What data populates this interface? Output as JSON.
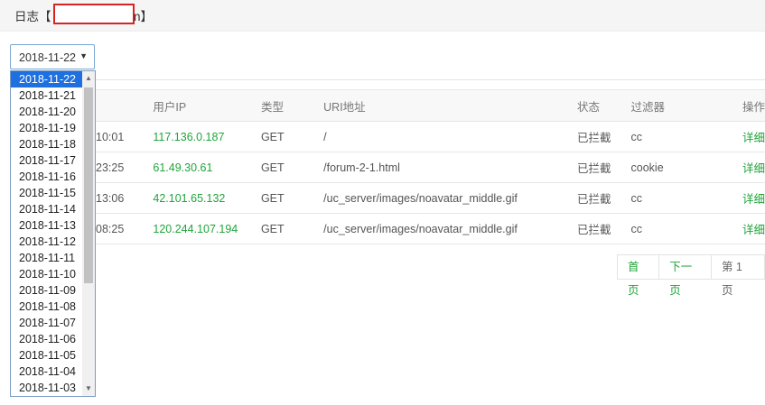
{
  "header": {
    "title_prefix": "日志【",
    "title_visible_tail": "n】"
  },
  "date_select": {
    "value": "2018-11-22"
  },
  "date_options": [
    "2018-11-22",
    "2018-11-21",
    "2018-11-20",
    "2018-11-19",
    "2018-11-18",
    "2018-11-17",
    "2018-11-16",
    "2018-11-15",
    "2018-11-14",
    "2018-11-13",
    "2018-11-12",
    "2018-11-11",
    "2018-11-10",
    "2018-11-09",
    "2018-11-08",
    "2018-11-07",
    "2018-11-06",
    "2018-11-05",
    "2018-11-04",
    "2018-11-03"
  ],
  "table": {
    "headers": {
      "ip": "用户IP",
      "type": "类型",
      "uri": "URI地址",
      "status": "状态",
      "filter": "过滤器",
      "op": "操作"
    },
    "rows": [
      {
        "time": "10:01",
        "ip": "117.136.0.187",
        "type": "GET",
        "uri": "/",
        "status": "已拦截",
        "filter": "cc",
        "op": "详细"
      },
      {
        "time": "23:25",
        "ip": "61.49.30.61",
        "type": "GET",
        "uri": "/forum-2-1.html",
        "status": "已拦截",
        "filter": "cookie",
        "op": "详细"
      },
      {
        "time": "13:06",
        "ip": "42.101.65.132",
        "type": "GET",
        "uri": "/uc_server/images/noavatar_middle.gif",
        "status": "已拦截",
        "filter": "cc",
        "op": "详细"
      },
      {
        "time": "08:25",
        "ip": "120.244.107.194",
        "type": "GET",
        "uri": "/uc_server/images/noavatar_middle.gif",
        "status": "已拦截",
        "filter": "cc",
        "op": "详细"
      }
    ]
  },
  "pager": {
    "first": "首页",
    "next": "下一页",
    "page": "第 1 页"
  },
  "colors": {
    "accent": "#20a53a",
    "selected": "#1e6fe0",
    "redact": "#d62323"
  }
}
